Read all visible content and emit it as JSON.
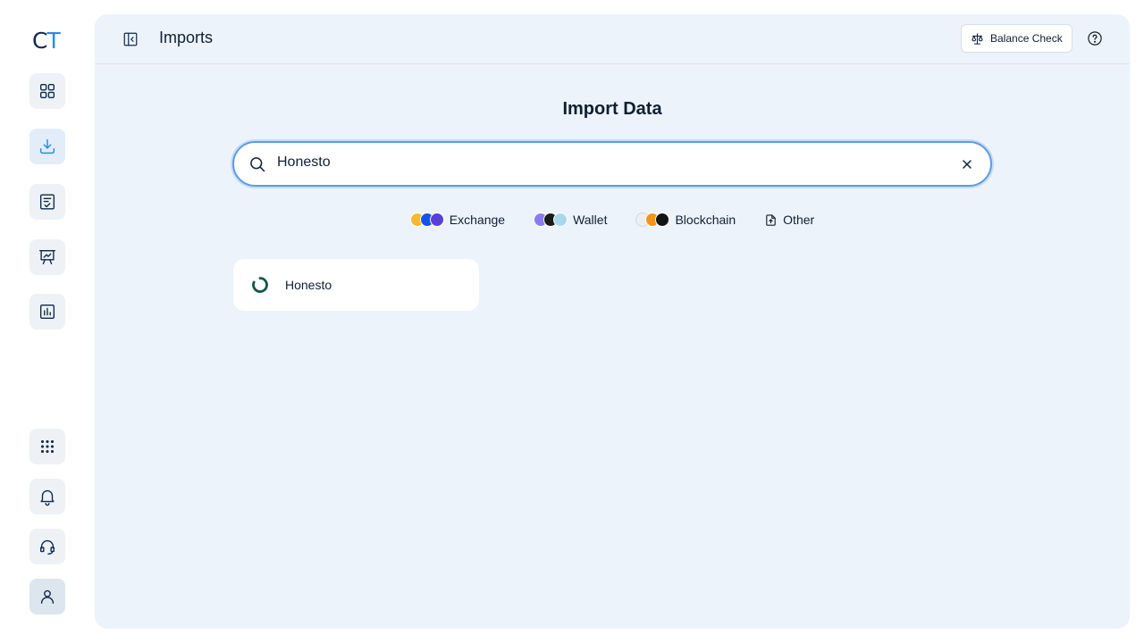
{
  "app": {
    "logo_c": "C",
    "logo_t": "T"
  },
  "header": {
    "title": "Imports",
    "balance_check_label": "Balance Check"
  },
  "main": {
    "heading": "Import Data",
    "search": {
      "value": "Honesto"
    },
    "filters": [
      {
        "label": "Exchange",
        "icon": "exchange-logos"
      },
      {
        "label": "Wallet",
        "icon": "wallet-logos"
      },
      {
        "label": "Blockchain",
        "icon": "blockchain-logos"
      },
      {
        "label": "Other",
        "icon": "file-upload-icon"
      }
    ],
    "results": [
      {
        "name": "Honesto",
        "icon": "honesto-logo"
      }
    ]
  },
  "colors": {
    "accent": "#2b8be8",
    "panel": "#edf3fa",
    "focus": "#5b9be6",
    "honesto": "#0e5a4a"
  }
}
